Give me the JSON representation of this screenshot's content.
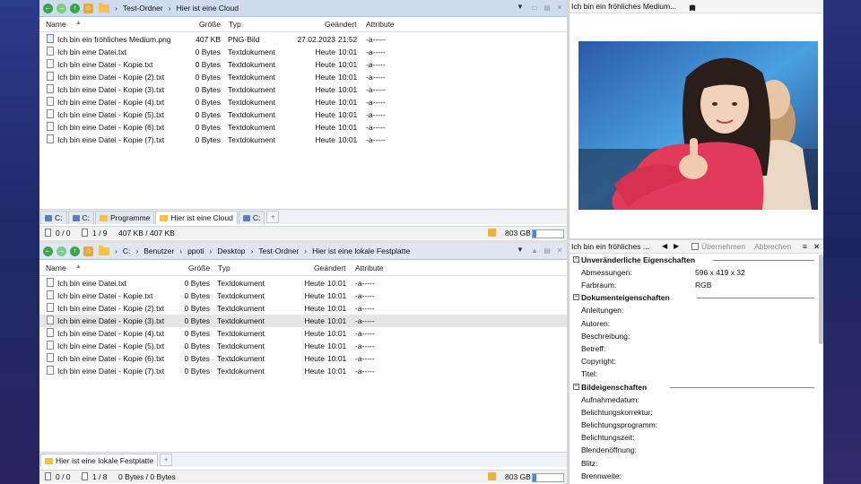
{
  "top_pane": {
    "breadcrumbs": [
      "Test-Ordner",
      "Hier ist eine Cloud"
    ],
    "columns": {
      "name": "Name",
      "size": "Größe",
      "type": "Typ",
      "changed": "Geändert",
      "attributes": "Attribute"
    },
    "rows": [
      {
        "name": "Ich bin ein fröhliches Medium.png",
        "size": "407 KB",
        "type": "PNG-Bild",
        "date": "27.02.2023",
        "time": "21:52",
        "attr": "-a-----",
        "icon": "png-file-icon"
      },
      {
        "name": "Ich bin eine Datei.txt",
        "size": "0 Bytes",
        "type": "Textdokument",
        "date": "Heute",
        "time": "10:01",
        "attr": "-a-----",
        "icon": "text-file-icon"
      },
      {
        "name": "Ich bin eine Datei - Kopie.txt",
        "size": "0 Bytes",
        "type": "Textdokument",
        "date": "Heute",
        "time": "10:01",
        "attr": "-a-----",
        "icon": "text-file-icon"
      },
      {
        "name": "Ich bin eine Datei - Kopie (2).txt",
        "size": "0 Bytes",
        "type": "Textdokument",
        "date": "Heute",
        "time": "10:01",
        "attr": "-a-----",
        "icon": "text-file-icon"
      },
      {
        "name": "Ich bin eine Datei - Kopie (3).txt",
        "size": "0 Bytes",
        "type": "Textdokument",
        "date": "Heute",
        "time": "10:01",
        "attr": "-a-----",
        "icon": "text-file-icon"
      },
      {
        "name": "Ich bin eine Datei - Kopie (4).txt",
        "size": "0 Bytes",
        "type": "Textdokument",
        "date": "Heute",
        "time": "10:01",
        "attr": "-a-----",
        "icon": "text-file-icon"
      },
      {
        "name": "Ich bin eine Datei - Kopie (5).txt",
        "size": "0 Bytes",
        "type": "Textdokument",
        "date": "Heute",
        "time": "10:01",
        "attr": "-a-----",
        "icon": "text-file-icon"
      },
      {
        "name": "Ich bin eine Datei - Kopie (6).txt",
        "size": "0 Bytes",
        "type": "Textdokument",
        "date": "Heute",
        "time": "10:01",
        "attr": "-a-----",
        "icon": "text-file-icon"
      },
      {
        "name": "Ich bin eine Datei - Kopie (7).txt",
        "size": "0 Bytes",
        "type": "Textdokument",
        "date": "Heute",
        "time": "10:01",
        "attr": "-a-----",
        "icon": "text-file-icon"
      }
    ],
    "tabs": [
      {
        "label": "C:",
        "kind": "drive"
      },
      {
        "label": "C:",
        "kind": "drive"
      },
      {
        "label": "Programme",
        "kind": "folder"
      },
      {
        "label": "Hier ist eine Cloud",
        "kind": "folder",
        "active": true
      },
      {
        "label": "C:",
        "kind": "drive"
      }
    ],
    "status": {
      "selected": "0 / 0",
      "files": "1 / 9",
      "size": "407 KB / 407 KB",
      "free": "803 GB",
      "disk_fill": 0.12
    }
  },
  "bottom_pane": {
    "breadcrumbs": [
      "C:",
      "Benutzer",
      "ppoti",
      "Desktop",
      "Test-Ordner",
      "Hier ist eine lokale Festplatte"
    ],
    "columns": {
      "name": "Name",
      "size": "Größe",
      "type": "Typ",
      "changed": "Geändert",
      "attributes": "Attribute"
    },
    "rows": [
      {
        "name": "Ich bin eine Datei.txt",
        "size": "0 Bytes",
        "type": "Textdokument",
        "date": "Heute",
        "time": "10:01",
        "attr": "-a-----"
      },
      {
        "name": "Ich bin eine Datei - Kopie.txt",
        "size": "0 Bytes",
        "type": "Textdokument",
        "date": "Heute",
        "time": "10:01",
        "attr": "-a-----"
      },
      {
        "name": "Ich bin eine Datei - Kopie (2).txt",
        "size": "0 Bytes",
        "type": "Textdokument",
        "date": "Heute",
        "time": "10:01",
        "attr": "-a-----"
      },
      {
        "name": "Ich bin eine Datei - Kopie (3).txt",
        "size": "0 Bytes",
        "type": "Textdokument",
        "date": "Heute",
        "time": "10:01",
        "attr": "-a-----",
        "selected": true
      },
      {
        "name": "Ich bin eine Datei - Kopie (4).txt",
        "size": "0 Bytes",
        "type": "Textdokument",
        "date": "Heute",
        "time": "10:01",
        "attr": "-a-----"
      },
      {
        "name": "Ich bin eine Datei - Kopie (5).txt",
        "size": "0 Bytes",
        "type": "Textdokument",
        "date": "Heute",
        "time": "10:01",
        "attr": "-a-----"
      },
      {
        "name": "Ich bin eine Datei - Kopie (6).txt",
        "size": "0 Bytes",
        "type": "Textdokument",
        "date": "Heute",
        "time": "10:01",
        "attr": "-a-----"
      },
      {
        "name": "Ich bin eine Datei - Kopie (7).txt",
        "size": "0 Bytes",
        "type": "Textdokument",
        "date": "Heute",
        "time": "10:01",
        "attr": "-a-----"
      }
    ],
    "tabs": [
      {
        "label": "Hier ist eine lokale Festplatte",
        "kind": "folder",
        "active": true
      }
    ],
    "status": {
      "selected": "0 / 0",
      "files": "1 / 8",
      "size": "0 Bytes / 0 Bytes",
      "free": "803 GB",
      "disk_fill": 0.12
    }
  },
  "preview": {
    "title": "Ich bin ein fröhliches Medium...",
    "image_alt": "photo-woman-thumbs-up"
  },
  "metadata_panel": {
    "title": "Ich bin ein fröhliches ...",
    "apply_label": "Übernehmen",
    "cancel_label": "Abbrechen",
    "sections": [
      {
        "title": "Unveränderliche Eigenschaften",
        "props": [
          {
            "label": "Abmessungen:",
            "value": "596 x 419 x 32"
          },
          {
            "label": "Farbraum:",
            "value": "RGB"
          }
        ]
      },
      {
        "title": "Dokumenteigenschaften",
        "props": [
          {
            "label": "Anleitungen:",
            "value": ""
          },
          {
            "label": "Autoren:",
            "value": ""
          },
          {
            "label": "Beschreibung:",
            "value": ""
          },
          {
            "label": "Betreff:",
            "value": ""
          },
          {
            "label": "Copyright:",
            "value": ""
          },
          {
            "label": "Titel:",
            "value": ""
          }
        ]
      },
      {
        "title": "Bildeigenschaften",
        "props": [
          {
            "label": "Aufnahmedatum:",
            "value": ""
          },
          {
            "label": "Belichtungskorrektur:",
            "value": ""
          },
          {
            "label": "Belichtungsprogramm:",
            "value": ""
          },
          {
            "label": "Belichtungszeit:",
            "value": ""
          },
          {
            "label": "Blendenöffnung:",
            "value": ""
          },
          {
            "label": "Blitz:",
            "value": ""
          },
          {
            "label": "Brennweite:",
            "value": ""
          }
        ]
      }
    ]
  },
  "colors": {
    "accent_blue": "#3a8ee6",
    "folder_yellow": "#f2c14e",
    "nav_green": "#3fa34d"
  }
}
